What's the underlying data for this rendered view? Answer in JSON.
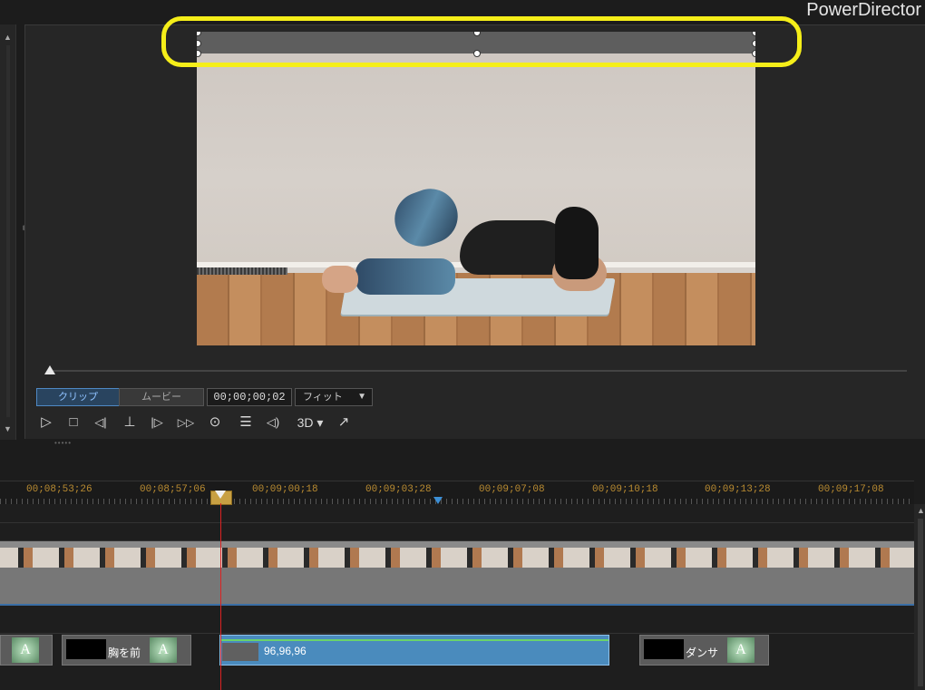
{
  "app": {
    "title": "PowerDirector"
  },
  "preview": {
    "mode_tabs": [
      {
        "label": "クリップ",
        "active": true
      },
      {
        "label": "ムービー",
        "active": false
      }
    ],
    "timecode": "00;00;00;02",
    "zoom": {
      "selected": "フィット"
    },
    "transport": {
      "play_icon": "▷",
      "stop_icon": "□",
      "prev_frame_icon": "◁|",
      "split_icon": "⊥",
      "next_frame_icon": "|▷",
      "fast_forward_icon": "▷▷",
      "snapshot_icon": "⊙",
      "subtitles_icon": "☰",
      "volume_icon": "◁)",
      "mode_3d_label": "3D ▾",
      "undock_icon": "↗"
    },
    "playback_position": 0.0
  },
  "timeline": {
    "ruler_ticks": [
      "00;08;53;26",
      "00;08;57;06",
      "00;09;00;18",
      "00;09;03;28",
      "00;09;07;08",
      "00;09;10;18",
      "00;09;13;28",
      "00;09;17;08"
    ],
    "title_clips": [
      {
        "label": "胸を前"
      },
      {
        "label": "96,96,96",
        "selected": true
      },
      {
        "label": "ダンサ"
      }
    ]
  },
  "colors": {
    "accent": "#4f89c5",
    "highlight": "#f5ee19",
    "playhead": "#dd2222",
    "selected_clip": "#4a8bbd"
  }
}
